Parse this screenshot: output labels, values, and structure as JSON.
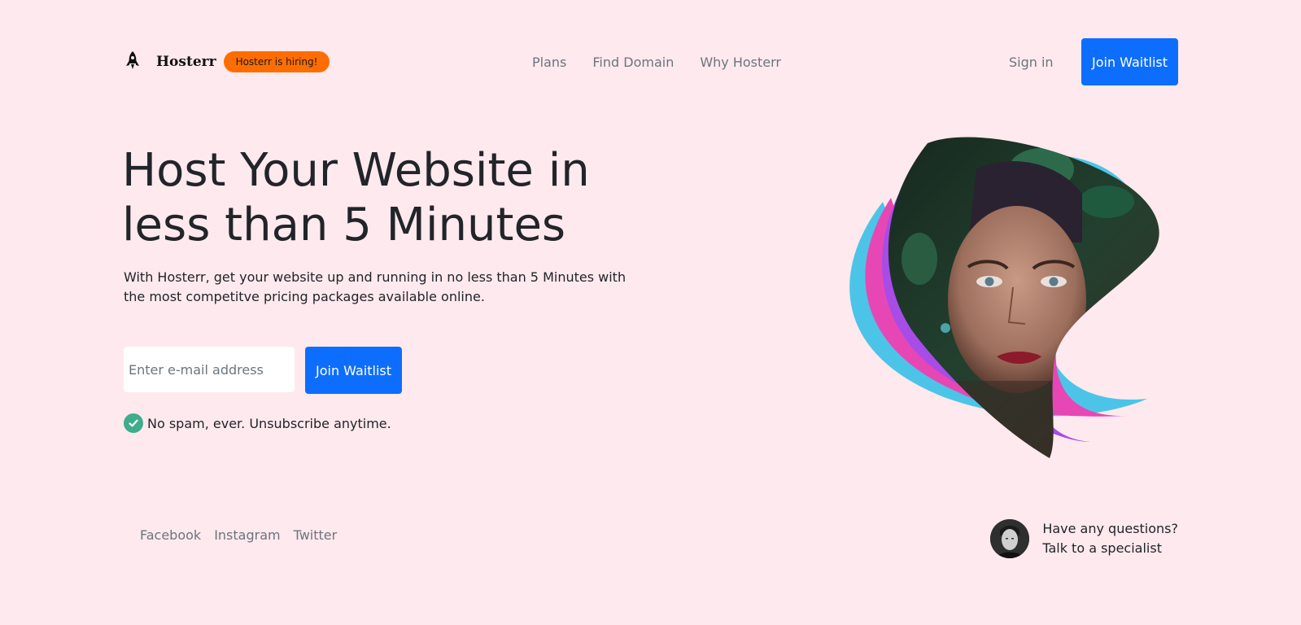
{
  "header": {
    "brand": "Hosterr",
    "hiring_badge": "Hosterr is hiring!",
    "nav": [
      "Plans",
      "Find Domain",
      "Why Hosterr"
    ],
    "signin": "Sign in",
    "cta": "Join Waitlist"
  },
  "hero": {
    "title_line1": "Host Your Website in",
    "title_line2": "less than 5 Minutes",
    "subtitle": "With Hosterr, get your website up and running in no less than 5 Minutes with the most competitve pricing packages available online.",
    "email_placeholder": "Enter e-mail address",
    "cta": "Join Waitlist",
    "note": "No spam, ever. Unsubscribe anytime."
  },
  "footer": {
    "social": [
      "Facebook",
      "Instagram",
      "Twitter"
    ],
    "help_line1": "Have any questions?",
    "help_line2": "Talk to a specialist"
  },
  "colors": {
    "background": "#fee9ee",
    "primary": "#0d6efd",
    "badge": "#ff6d00",
    "check": "#3fac8c"
  },
  "icons": {
    "logo": "rocket-icon",
    "check": "check-circle-icon"
  }
}
